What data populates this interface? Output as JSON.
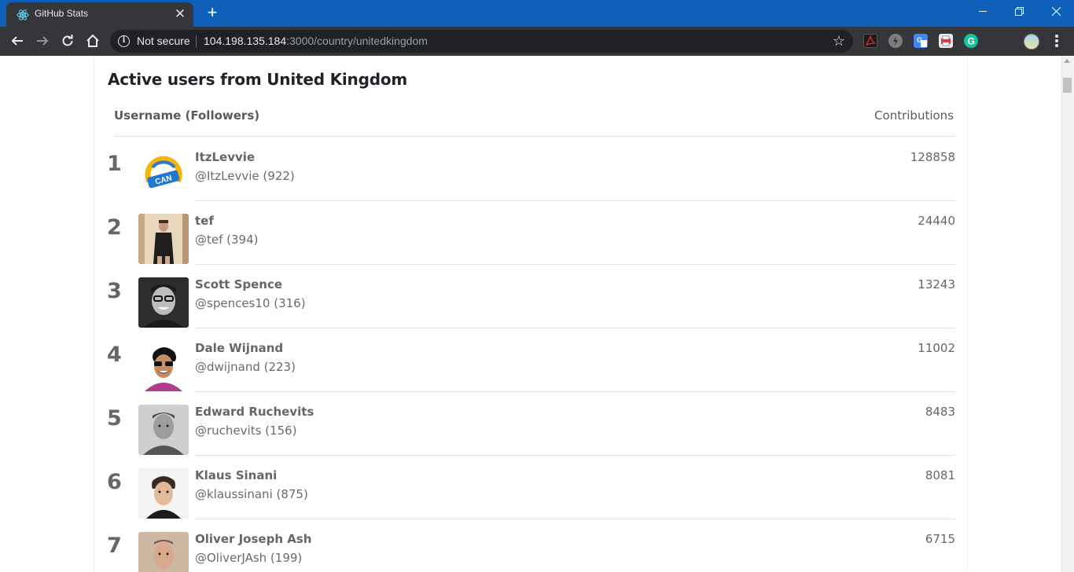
{
  "browser": {
    "tab_title": "GitHub Stats",
    "security_label": "Not secure",
    "url_host": "104.198.135.184",
    "url_path": ":3000/country/unitedkingdom"
  },
  "page": {
    "title": "Active users from United Kingdom",
    "col_username": "Username (Followers)",
    "col_contributions": "Contributions"
  },
  "users": [
    {
      "rank": "1",
      "name": "ItzLevvie",
      "handle": "@ItzLevvie (922)",
      "contributions": "128858"
    },
    {
      "rank": "2",
      "name": "tef",
      "handle": "@tef (394)",
      "contributions": "24440"
    },
    {
      "rank": "3",
      "name": "Scott Spence",
      "handle": "@spences10 (316)",
      "contributions": "13243"
    },
    {
      "rank": "4",
      "name": "Dale Wijnand",
      "handle": "@dwijnand (223)",
      "contributions": "11002"
    },
    {
      "rank": "5",
      "name": "Edward Ruchevits",
      "handle": "@ruchevits (156)",
      "contributions": "8483"
    },
    {
      "rank": "6",
      "name": "Klaus Sinani",
      "handle": "@klaussinani (875)",
      "contributions": "8081"
    },
    {
      "rank": "7",
      "name": "Oliver Joseph Ash",
      "handle": "@OliverJAsh (199)",
      "contributions": "6715"
    }
  ],
  "avatars": {
    "can_logo_text": "CAN"
  },
  "colors": {
    "titlebar": "#0d5fb7",
    "toolbar": "#35363a",
    "tab": "#35363a",
    "text_muted": "#666666"
  }
}
